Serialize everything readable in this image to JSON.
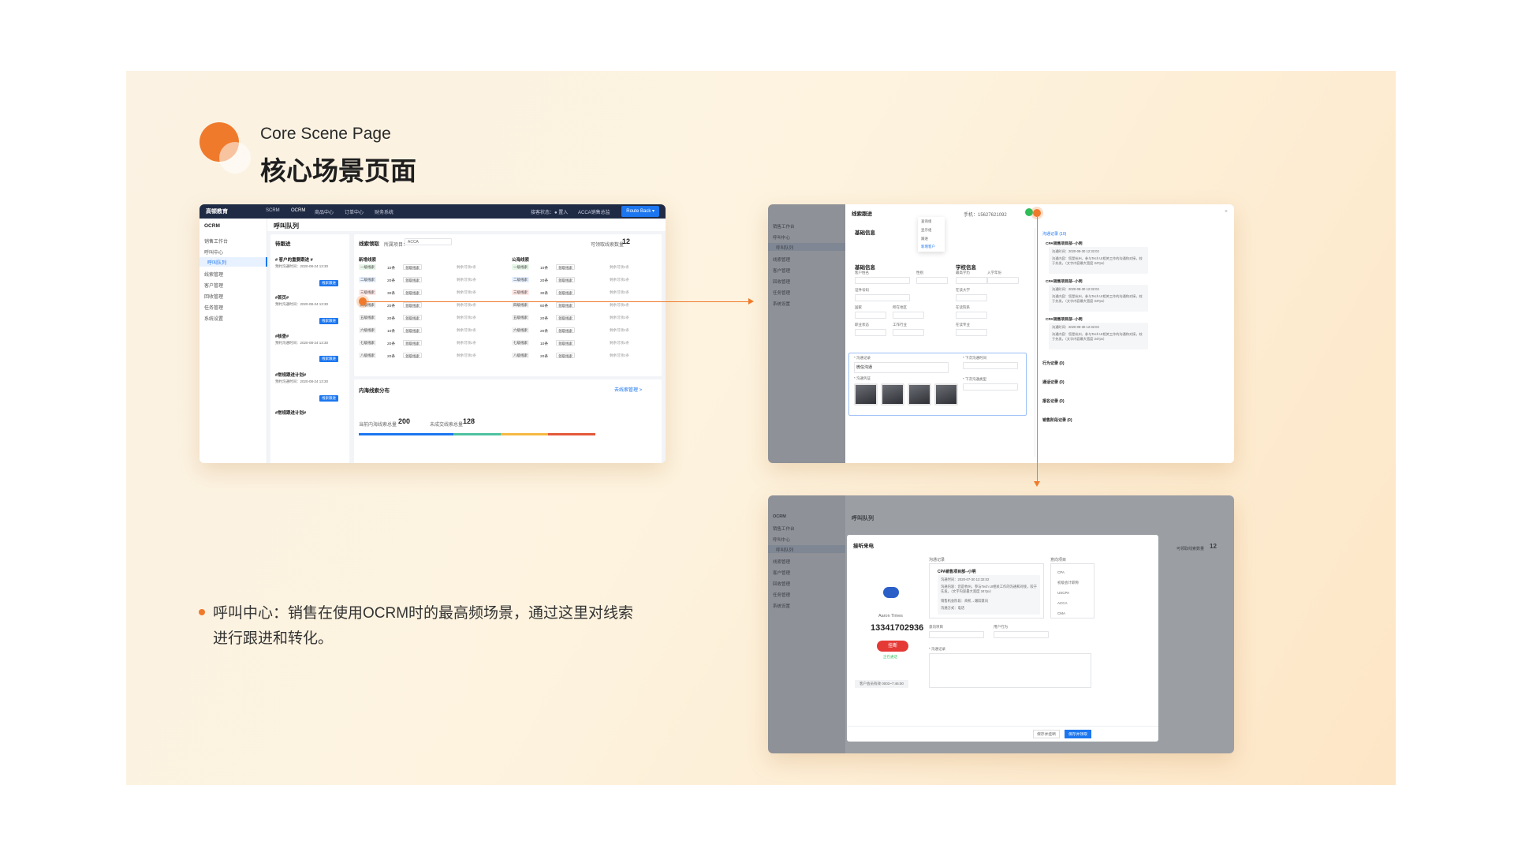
{
  "header": {
    "subtitle_en": "Core Scene Page",
    "title_cn": "核心场景页面"
  },
  "description": {
    "line1": "呼叫中心：销售在使用OCRM时的最高频场景，通过这里对线索",
    "line2": "进行跟进和转化。"
  },
  "colors": {
    "accent": "#f07a2c",
    "brand_blue": "#1b76f0",
    "nav_dark": "#1f2a44"
  },
  "screen1": {
    "brand": "高顿教育",
    "nav": [
      "SCRM",
      "OCRM",
      "商品中心",
      "订单中心",
      "财务系统"
    ],
    "status": "接客状态：● 置入",
    "account": "ACCA销售总监",
    "route_btn": "Route Back ▾",
    "app_title": "OCRM",
    "sidebar": [
      "销售工作台",
      "呼叫中心",
      "呼叫队列",
      "线索管理",
      "客户管理",
      "回收管理",
      "任务管理",
      "系统设置"
    ],
    "page_title": "呼叫队列",
    "queue_title": "待跟进",
    "queue_items": [
      "# 客户的重要跟进 #",
      "#首页#",
      "#核查#",
      "#常规跟进计划#",
      "#常规跟进计划#"
    ],
    "queue_meta": "预约沟通时间：2020-08-24 13:30",
    "queue_btn": "线索跟进",
    "clue_title": "线索领取",
    "project_label": "所属项目：",
    "project_value": "ACCA",
    "count_label": "可领取线索数量",
    "count_value": "12",
    "left_col": "新增线索",
    "right_col": "公海线索",
    "levels": [
      "一级线索",
      "二级线索",
      "三级线索",
      "四级线索",
      "五级线索",
      "六级线索",
      "七级线索",
      "八级线索"
    ],
    "left_counts": [
      "10条",
      "20条",
      "30条",
      "20条",
      "20条",
      "10条",
      "20条",
      "20条"
    ],
    "right_counts": [
      "10条",
      "20条",
      "30条",
      "60条",
      "20条",
      "20条",
      "10条",
      "20条"
    ],
    "claim": "领取线索",
    "remain": "剩余可领2条",
    "dist_title": "内海线索分布",
    "dist_link": "去线索管理 >",
    "dist_stat1": "当前内海线索总量",
    "dist_val1": "200",
    "dist_stat2": "未成交线索总量",
    "dist_val2": "128"
  },
  "screen2": {
    "drawer_title": "线索跟进",
    "phone": "手机：15627621092",
    "section_basic": "基础信息",
    "section_person": "基础信息",
    "section_school": "学校信息",
    "fields": [
      "客户姓名",
      "性别",
      "证件号码",
      "国家",
      "所在地区",
      "职业状态",
      "工作行业",
      "最高学历",
      "入学年份",
      "在读大学",
      "在读院系",
      "在读专业"
    ],
    "menu": [
      "查询组",
      "显示组",
      "跟进",
      "新增客户"
    ],
    "follow_label": "* 沟通记录",
    "follow_value": "微信沟通",
    "next_time": "* 下次沟通时间",
    "next_type": "* 下次沟通类型",
    "proof": "* 沟通凭证",
    "timeline_title": "沟通记录 (10)",
    "tl_item": "CPA销售项目部--小明",
    "tl_time": "沟通时间：2020-08-30 12:32:02",
    "tl_text": "沟通内容：您是杭州，参与Tech UI相关工作的沟通和对接，较于先发。（文字内容最大宽度 347px）",
    "collapse": [
      "行为记录 (0)",
      "通话记录 (0)",
      "报名记录 (0)",
      "销售阶段记录 (0)"
    ]
  },
  "screen3": {
    "app_title": "OCRM",
    "page_title": "呼叫队列",
    "modal_title": "接听来电",
    "caller": "Aaron Times",
    "number": "13341702936",
    "hangup": "挂断",
    "duration": "正在通话",
    "hint": "客户会员有效 0003~7:46:00",
    "history_title": "沟通记录",
    "hist_item": "CPA销售项目部--小明",
    "hist_time": "沟通时间：2020-07-30 12:32:02",
    "hist_text": "沟通内容：您是杭州，参与Tech UI相关工作的沟通和对接，较于先发。（文字内容最大宽度 347px）",
    "hist_owner": "销售机会阶段：商机→跟踪意向",
    "hist_type": "沟通方式：电话",
    "intent_title": "意向项目",
    "projects": [
      "CPA",
      "初级会计职称",
      "USCPA",
      "ACCA",
      "CMA"
    ],
    "intent_label": "意向项目",
    "behavior_label": "用户行为",
    "record_label": "* 沟通记录",
    "btn_save_close": "保存并挂断",
    "btn_save_next": "保存并领取",
    "count_label": "可领取线索数量",
    "count_value": "12"
  }
}
